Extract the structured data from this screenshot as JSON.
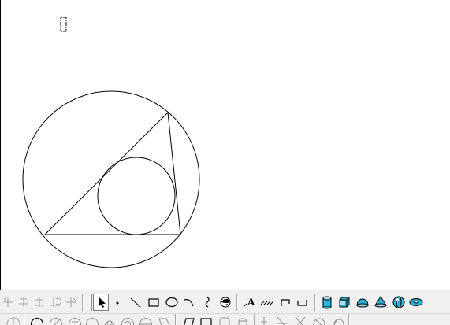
{
  "app": {
    "name": "drawing canvas",
    "colors": {
      "canvas_bg": "#ffffff",
      "toolbar_bg": "#f0f0f0",
      "stroke": "#000000",
      "solid_icon": "#29b6d6"
    }
  },
  "drawing": {
    "shapes": [
      "circumscribed-circle",
      "triangle",
      "inscribed-circle",
      "text-cursor"
    ]
  },
  "toolbar_row1": {
    "disabled_tools": [
      "snap-endpoint-icon",
      "snap-midpoint-icon",
      "snap-perpendicular-icon",
      "snap-tangent-icon",
      "snap-intersection-icon"
    ],
    "draw_tools": [
      "select-arrow-icon",
      "point-icon",
      "line-icon",
      "rectangle-icon",
      "ellipse-icon",
      "arc-icon",
      "spline-icon",
      "symbol-icon"
    ],
    "annotation_tools": [
      "text-icon",
      "hatch-icon",
      "dimension-icon",
      "leader-icon"
    ],
    "solid_tools": [
      "cylinder-icon",
      "box-icon",
      "half-sphere-icon",
      "cone-icon",
      "sphere-icon",
      "torus-icon"
    ],
    "selected": "select-arrow-icon",
    "text_tool_glyph": "A"
  },
  "toolbar_row2": {
    "tools": [
      "circle-tool-icon",
      "circle-2pt-icon",
      "circle-3pt-icon",
      "circle-tangent-icon",
      "ellipse-tool-icon",
      "arc-tool-icon",
      "polygon-tool-icon",
      "parallelogram-icon",
      "square-icon",
      "rounded-rect-icon",
      "cylinder-tool-icon",
      "vertical-line-icon",
      "angle-line-icon",
      "cross-line-icon",
      "bisector-icon",
      "tangent-circle-icon"
    ]
  }
}
